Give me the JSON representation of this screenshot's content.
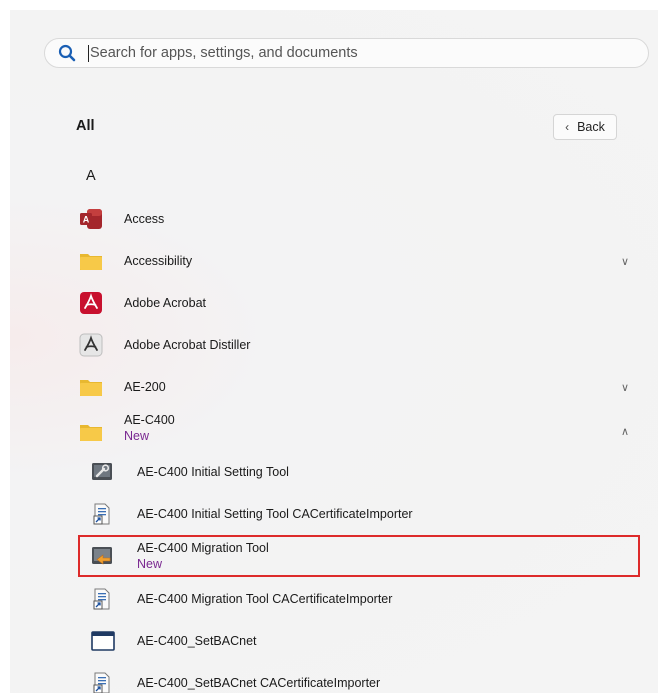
{
  "search": {
    "placeholder": "Search for apps, settings, and documents",
    "icon": "search-icon"
  },
  "header": {
    "title": "All",
    "back_label": "Back",
    "back_icon": "chevron-left-icon"
  },
  "section_letter": "A",
  "apps": [
    {
      "label": "Access",
      "icon": "access-icon"
    },
    {
      "label": "Accessibility",
      "icon": "folder-icon",
      "expand": "chevron-down-icon"
    },
    {
      "label": "Adobe Acrobat",
      "icon": "adobe-acrobat-icon"
    },
    {
      "label": "Adobe Acrobat Distiller",
      "icon": "acrobat-distiller-icon"
    },
    {
      "label": "AE-200",
      "icon": "folder-icon",
      "expand": "chevron-down-icon"
    },
    {
      "label": "AE-C400",
      "badge": "New",
      "icon": "folder-icon",
      "expand": "chevron-up-icon"
    }
  ],
  "subapps": [
    {
      "label": "AE-C400 Initial Setting Tool",
      "icon": "setting-tool-icon"
    },
    {
      "label": "AE-C400 Initial Setting Tool CACertificateImporter",
      "icon": "shortcut-file-icon"
    },
    {
      "label": "AE-C400 Migration Tool",
      "badge": "New",
      "icon": "migration-tool-icon",
      "highlighted": true
    },
    {
      "label": "AE-C400 Migration Tool CACertificateImporter",
      "icon": "shortcut-file-icon"
    },
    {
      "label": "AE-C400_SetBACnet",
      "icon": "window-icon"
    },
    {
      "label": "AE-C400_SetBACnet CACertificateImporter",
      "icon": "shortcut-file-icon"
    }
  ],
  "colors": {
    "new_badge": "#7a2891",
    "highlight_border": "#dd2a2a",
    "search_icon": "#1a5fb4"
  }
}
